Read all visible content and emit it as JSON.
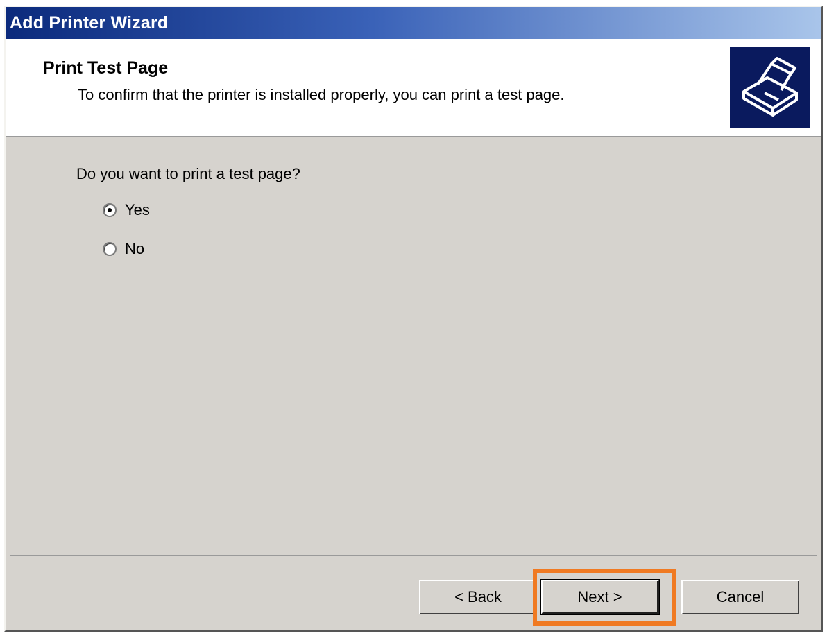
{
  "window": {
    "title": "Add Printer Wizard"
  },
  "header": {
    "title": "Print Test Page",
    "subtitle": "To confirm that the printer is installed properly, you can print a test page.",
    "icon": "printer-icon"
  },
  "body": {
    "question": "Do you want to print a test page?",
    "options": [
      {
        "label": "Yes",
        "selected": true
      },
      {
        "label": "No",
        "selected": false
      }
    ]
  },
  "buttons": {
    "back": "< Back",
    "next": "Next >",
    "cancel": "Cancel"
  },
  "colors": {
    "highlight": "#f07a22",
    "icon_bg": "#0a1a5e"
  }
}
